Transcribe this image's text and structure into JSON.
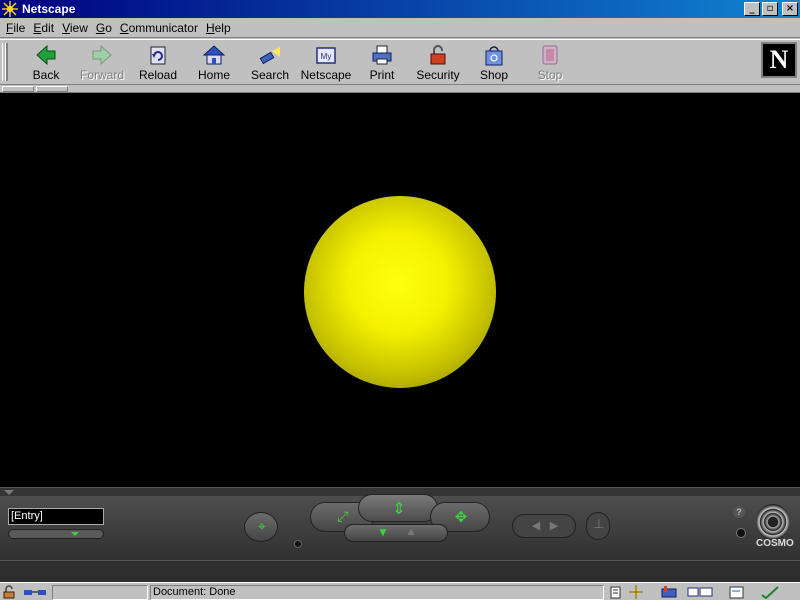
{
  "window": {
    "title": "Netscape",
    "min_glyph": "_",
    "max_glyph": "▫",
    "close_glyph": "×"
  },
  "menu": [
    {
      "label": "File",
      "key": "F",
      "rest": "ile"
    },
    {
      "label": "Edit",
      "key": "E",
      "rest": "dit"
    },
    {
      "label": "View",
      "key": "V",
      "rest": "iew"
    },
    {
      "label": "Go",
      "key": "G",
      "rest": "o"
    },
    {
      "label": "Communicator",
      "key": "C",
      "rest": "ommunicator"
    },
    {
      "label": "Help",
      "key": "H",
      "rest": "elp"
    }
  ],
  "toolbar": {
    "back": "Back",
    "forward": "Forward",
    "reload": "Reload",
    "home": "Home",
    "search": "Search",
    "netscape": "Netscape",
    "print": "Print",
    "security": "Security",
    "shop": "Shop",
    "stop": "Stop",
    "logo": "N"
  },
  "colors": {
    "title_bar": "#000080",
    "viewer_bg": "#000000",
    "sphere": "#f4f000",
    "console_bg": "#353535",
    "console_accent": "#3fd43f"
  },
  "viewer": {
    "object": "yellow-sphere"
  },
  "console": {
    "viewpoint": "[Entry]",
    "help_glyph": "?",
    "brand": "COSMO"
  },
  "status": {
    "message": "Document: Done"
  }
}
